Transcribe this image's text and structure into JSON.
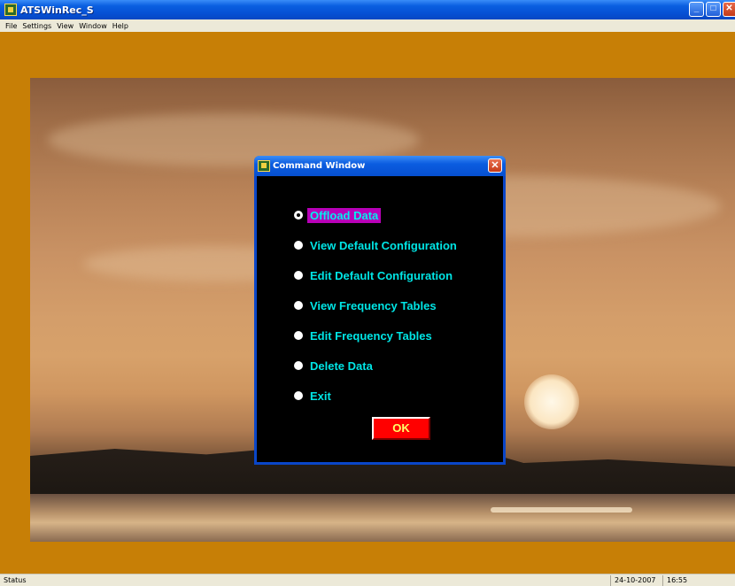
{
  "app": {
    "title": "ATSWinRec_S",
    "window_buttons": {
      "minimize": "_",
      "maximize": "□",
      "close": "✕"
    }
  },
  "menu": [
    "File",
    "Settings",
    "View",
    "Window",
    "Help"
  ],
  "dialog": {
    "title": "Command Window",
    "close_label": "✕",
    "options": [
      {
        "label": "Offload Data",
        "selected": true
      },
      {
        "label": "View Default Configuration",
        "selected": false
      },
      {
        "label": "Edit Default Configuration",
        "selected": false
      },
      {
        "label": "View Frequency Tables",
        "selected": false
      },
      {
        "label": "Edit Frequency Tables",
        "selected": false
      },
      {
        "label": "Delete Data",
        "selected": false
      },
      {
        "label": "Exit",
        "selected": false
      }
    ],
    "ok_label": "OK"
  },
  "status": {
    "text": "Status",
    "date": "24-10-2007",
    "time": "16:55"
  },
  "colors": {
    "client_background": "#c77f06",
    "dialog_body": "#000000",
    "option_text": "#00e5e5",
    "selected_highlight": "#b800b8",
    "ok_button": "#ff0000"
  }
}
